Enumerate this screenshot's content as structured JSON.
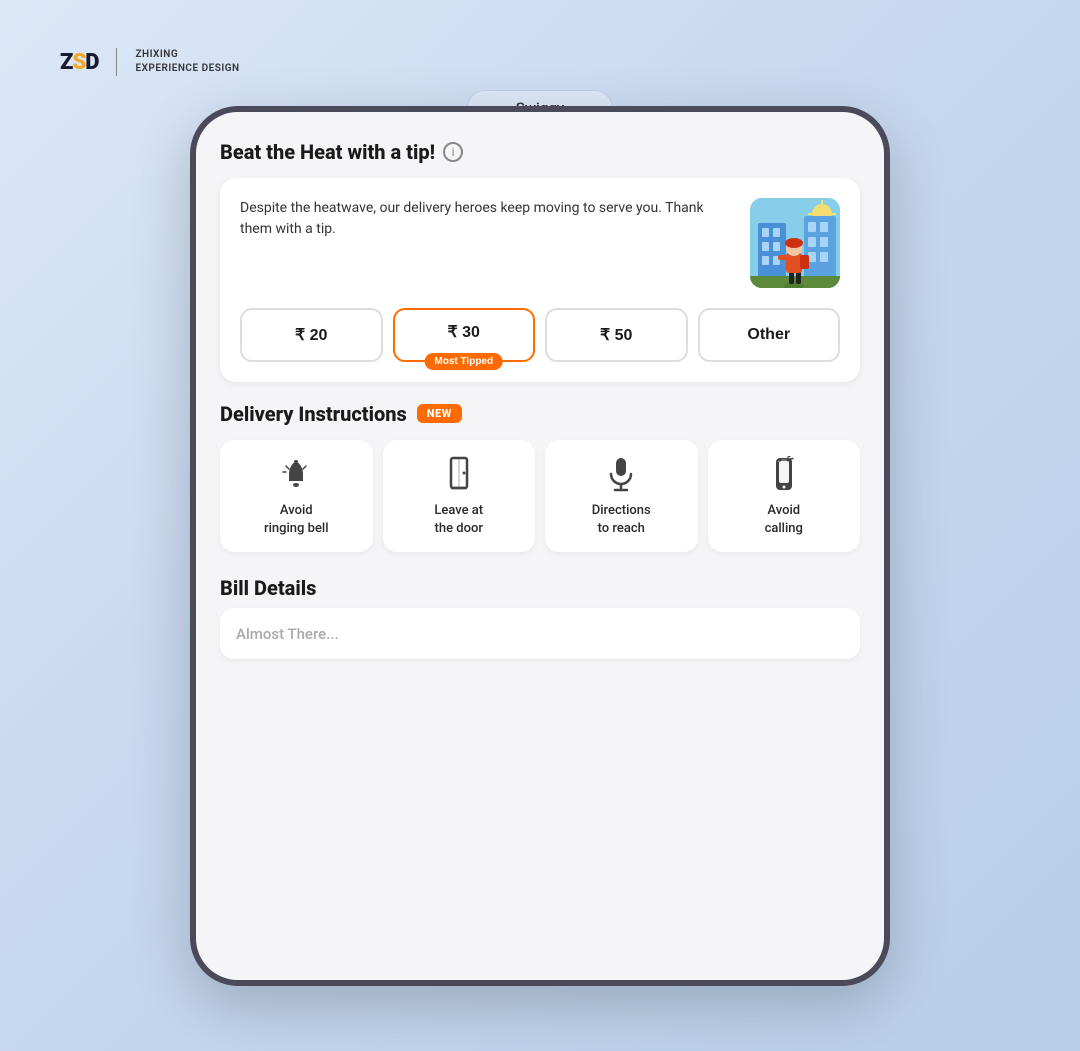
{
  "logo": {
    "icon_text": "ZSD",
    "company_line1": "ZHIXING",
    "company_line2": "EXPERIENCE  DESIGN"
  },
  "app_tab": {
    "label": "Swiggy"
  },
  "tip_section": {
    "title": "Beat the Heat with a tip!",
    "info_icon_label": "i",
    "description": "Despite the heatwave, our delivery heroes keep moving to serve you. Thank them with a tip.",
    "buttons": [
      {
        "label": "₹ 20",
        "selected": false,
        "badge": null
      },
      {
        "label": "₹ 30",
        "selected": true,
        "badge": "Most Tipped"
      },
      {
        "label": "₹ 50",
        "selected": false,
        "badge": null
      },
      {
        "label": "Other",
        "selected": false,
        "badge": null
      }
    ]
  },
  "delivery_instructions": {
    "title": "Delivery Instructions",
    "badge": "NEW",
    "items": [
      {
        "icon": "🔔",
        "label": "Avoid\nringing bell"
      },
      {
        "icon": "🚪",
        "label": "Leave at\nthe door"
      },
      {
        "icon": "🎤",
        "label": "Directions\nto reach"
      },
      {
        "icon": "📱",
        "label": "Avoid\ncalling"
      }
    ]
  },
  "bill_details": {
    "title": "Bill Details",
    "preview_text": "Almost There..."
  }
}
